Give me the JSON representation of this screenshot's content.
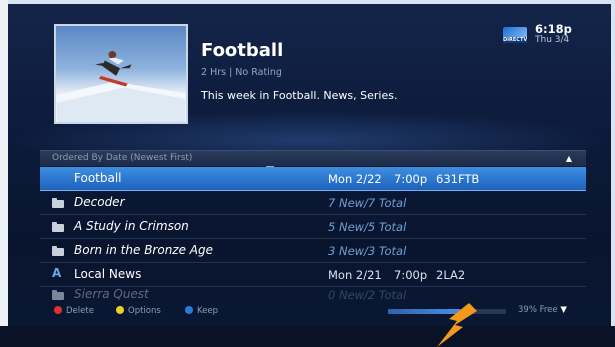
{
  "program": {
    "title": "Football",
    "meta": "2 Hrs | No Rating",
    "description": "This week in Football. News, Series."
  },
  "status": {
    "logo_text": "DIRECTV",
    "time": "6:18p",
    "date": "Thu 3/4"
  },
  "list": {
    "sort_label": "Ordered By Date (Newest First)",
    "rows": [
      {
        "name": "Football",
        "date": "Mon 2/22",
        "time": "7:00p",
        "channel": "631FTB",
        "icon": "none",
        "selected": true
      },
      {
        "name": "Decoder",
        "summary": "7 New/7 Total",
        "icon": "folder-icon"
      },
      {
        "name": "A Study in Crimson",
        "summary": "5 New/5 Total",
        "icon": "folder-icon"
      },
      {
        "name": "Born in the Bronze Age",
        "summary": "3 New/3 Total",
        "icon": "folder-icon"
      },
      {
        "name": "Local News",
        "date": "Mon 2/21",
        "time": "7:00p",
        "channel": "2LA2",
        "icon": "alpha-icon"
      },
      {
        "name": "Sierra Quest",
        "summary": "0 New/2 Total",
        "icon": "folder-icon",
        "faded": true
      }
    ]
  },
  "legend": {
    "delete": "Delete",
    "options": "Options",
    "keep": "Keep",
    "colors": {
      "delete": "#e0312b",
      "options": "#e8cf2a",
      "keep": "#2f79d6"
    }
  },
  "disk": {
    "used_fraction": 0.61,
    "free_label": "39% Free"
  },
  "colors": {
    "selection": "#2b75cf",
    "background": "#0c1a3a",
    "accent_text": "#6f9fd4",
    "pointer": "#f39a1c"
  }
}
